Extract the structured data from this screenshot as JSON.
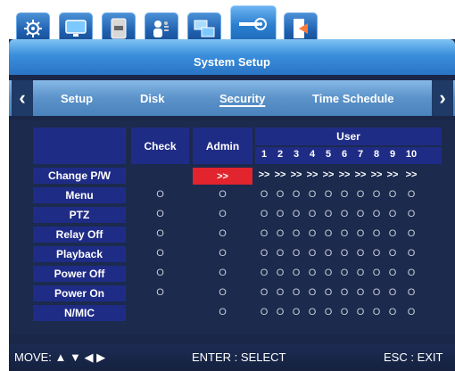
{
  "tabs": [
    {
      "icon": "gear-icon"
    },
    {
      "icon": "monitor-icon"
    },
    {
      "icon": "hdd-icon"
    },
    {
      "icon": "users-icon"
    },
    {
      "icon": "network-icon"
    },
    {
      "icon": "system-settings-icon",
      "active": true
    },
    {
      "icon": "exit-door-icon"
    }
  ],
  "header": {
    "title": "System Setup"
  },
  "nav": {
    "items": [
      "Setup",
      "Disk",
      "Security",
      "Time Schedule"
    ],
    "active": "Security"
  },
  "table": {
    "check_label": "Check",
    "admin_label": "Admin",
    "user_label": "User",
    "user_numbers": [
      "1",
      "2",
      "3",
      "4",
      "5",
      "6",
      "7",
      "8",
      "9",
      "10"
    ],
    "rows": [
      {
        "label": "Change P/W",
        "check": "",
        "admin": ">>",
        "users": ">>"
      },
      {
        "label": "Menu",
        "check": "O",
        "admin": "O",
        "users": "O"
      },
      {
        "label": "PTZ",
        "check": "O",
        "admin": "O",
        "users": "O"
      },
      {
        "label": "Relay Off",
        "check": "O",
        "admin": "O",
        "users": "O"
      },
      {
        "label": "Playback",
        "check": "O",
        "admin": "O",
        "users": "O"
      },
      {
        "label": "Power Off",
        "check": "O",
        "admin": "O",
        "users": "O"
      },
      {
        "label": "Power On",
        "check": "O",
        "admin": "O",
        "users": "O"
      },
      {
        "label": "N/MIC",
        "check": "",
        "admin": "O",
        "users": "O"
      }
    ]
  },
  "footer": {
    "move": "MOVE: ▲ ▼ ◀ ▶",
    "enter": "ENTER : SELECT",
    "esc": "ESC : EXIT"
  },
  "colors": {
    "highlight": "#e2242e",
    "header_bg": "#1f2c86",
    "panel": "#1a2748"
  }
}
